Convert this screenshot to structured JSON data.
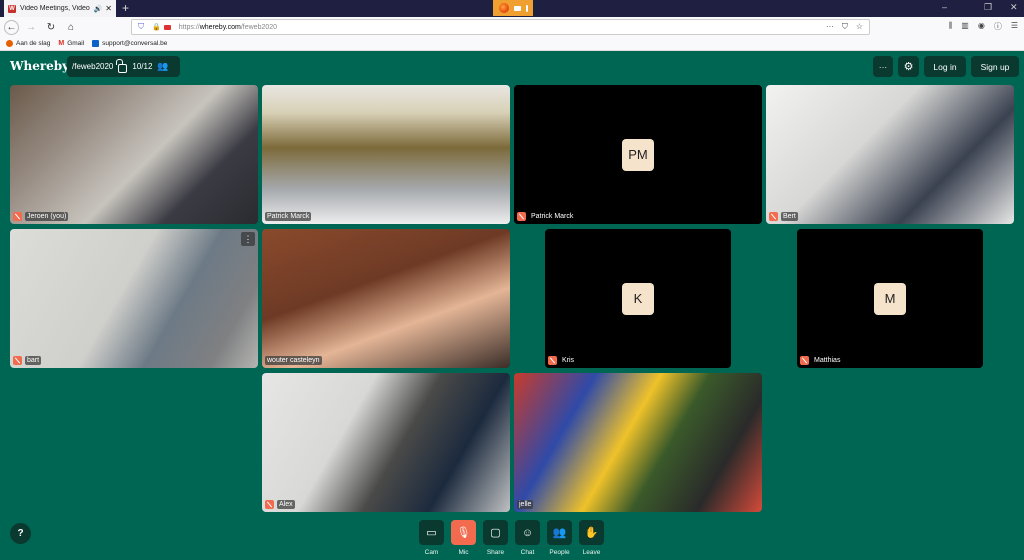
{
  "browser": {
    "tab_title": "Video Meetings, Video Con",
    "tab_favicon": "W",
    "new_tab": "+",
    "url_scheme": "https://",
    "url_domain": "whereby.com",
    "url_path": "/feweb2020",
    "window_controls": [
      "–",
      "❐",
      "✕"
    ],
    "bookmarks": [
      {
        "label": "Aan de slag",
        "icon": "firefox-icon",
        "color": "#e66000"
      },
      {
        "label": "Gmail",
        "icon": "gmail-icon",
        "color": "#d93025"
      },
      {
        "label": "support@conversal.be",
        "icon": "outlook-icon",
        "color": "#0a64c8"
      }
    ]
  },
  "header": {
    "logo": "Whereby",
    "room_name": "/feweb2020",
    "participant_count": "10/12",
    "more_label": "···",
    "login_label": "Log in",
    "signup_label": "Sign up"
  },
  "tiles": [
    {
      "name": "Jeroen (you)",
      "muted": true,
      "video": true,
      "initials": "",
      "bg": "linear-gradient(135deg,#6a5a4a 0%,#9a8f86 30%,#c7c4bd 55%,#3b3b44 75%,#2a2a30 100%)"
    },
    {
      "name": "Patrick Marck",
      "muted": false,
      "video": true,
      "initials": "",
      "bg": "linear-gradient(180deg,#e8e6e2 0%,#d8d0b6 20%,#7c6a3a 45%,#a6a9ad 75%,#eeeeee 100%)"
    },
    {
      "name": "Patrick Marck",
      "muted": true,
      "video": false,
      "initials": "PM",
      "bg": "#000"
    },
    {
      "name": "Bert",
      "muted": true,
      "video": true,
      "initials": "",
      "bg": "linear-gradient(135deg,#f2f2f0 0%,#d7d7d5 40%,#3a4150 70%,#e7e7e6 100%)"
    },
    {
      "name": "bart",
      "muted": true,
      "video": true,
      "initials": "",
      "bg": "linear-gradient(120deg,#dcdcd8 0%,#cfcfcb 45%,#6d7a86 65%,#7f8082 85%,#b5b5b2 100%)"
    },
    {
      "name": "wouter casteleyn",
      "muted": false,
      "video": true,
      "initials": "",
      "bg": "linear-gradient(160deg,#8a4a2c 0%,#6e3a25 40%,#e4b596 65%,#3a2d28 100%)"
    },
    {
      "name": "Kris",
      "muted": true,
      "video": false,
      "initials": "K",
      "bg": "#000"
    },
    {
      "name": "Matthias",
      "muted": true,
      "video": false,
      "initials": "M",
      "bg": "#000"
    },
    {
      "name": "Alex",
      "muted": true,
      "video": true,
      "initials": "",
      "bg": "linear-gradient(120deg,#e6e6e4 0%,#d8d8d6 35%,#4a4a48 55%,#1c2a3e 75%,#bfc1c2 100%)"
    },
    {
      "name": "jelle",
      "muted": false,
      "video": true,
      "initials": "",
      "bg": "linear-gradient(120deg,#c83b2c 0%,#2f4aa8 25%,#efc22a 45%,#3a5a2a 60%,#2a2a2a 80%,#d44a3a 100%)"
    }
  ],
  "toolbar": [
    {
      "label": "Cam",
      "icon": "camera-icon",
      "glyph": "▭",
      "active": false
    },
    {
      "label": "Mic",
      "icon": "mic-muted-icon",
      "glyph": "🎙",
      "active": true
    },
    {
      "label": "Share",
      "icon": "screen-share-icon",
      "glyph": "▢",
      "active": false
    },
    {
      "label": "Chat",
      "icon": "chat-icon",
      "glyph": "☺",
      "active": false
    },
    {
      "label": "People",
      "icon": "people-icon",
      "glyph": "👥",
      "active": false
    },
    {
      "label": "Leave",
      "icon": "wave-hand-icon",
      "glyph": "✋",
      "active": false
    }
  ],
  "help_label": "?"
}
